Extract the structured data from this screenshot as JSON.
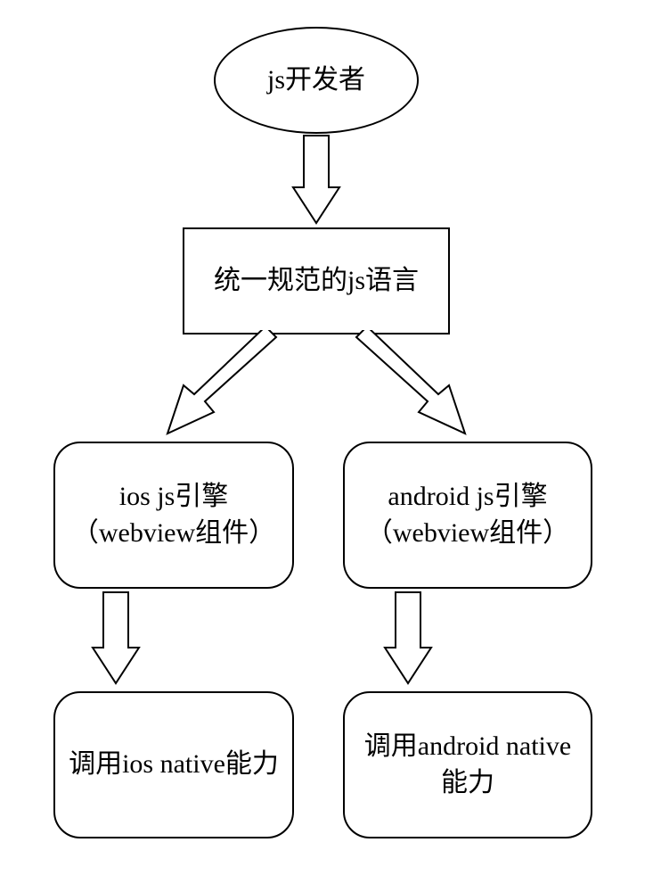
{
  "nodes": {
    "developer": "js开发者",
    "unified_js": "统一规范的js语言",
    "ios_engine": "ios js引擎（webview组件）",
    "android_engine": "android js引擎（webview组件）",
    "ios_native": "调用ios native能力",
    "android_native": "调用android native能力"
  }
}
